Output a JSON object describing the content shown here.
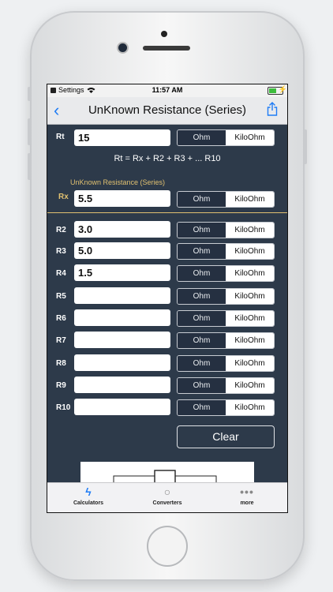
{
  "statusbar": {
    "carrier": "Settings",
    "time": "11:57 AM"
  },
  "navbar": {
    "back_glyph": "‹",
    "title": "UnKnown Resistance (Series)"
  },
  "units": {
    "ohm": "Ohm",
    "kiloohm": "KiloOhm"
  },
  "rt": {
    "label": "Rt",
    "value": "15"
  },
  "formula": "Rt = Rx + R2 + R3 + ... R10",
  "rx": {
    "caption": "UnKnown Resistance (Series)",
    "label": "Rx",
    "value": "5.5"
  },
  "rows": [
    {
      "label": "R2",
      "value": "3.0"
    },
    {
      "label": "R3",
      "value": "5.0"
    },
    {
      "label": "R4",
      "value": "1.5"
    },
    {
      "label": "R5",
      "value": ""
    },
    {
      "label": "R6",
      "value": ""
    },
    {
      "label": "R7",
      "value": ""
    },
    {
      "label": "R8",
      "value": ""
    },
    {
      "label": "R9",
      "value": ""
    },
    {
      "label": "R10",
      "value": ""
    }
  ],
  "clear_label": "Clear",
  "tabs": [
    {
      "label": "Calculators",
      "icon": "bolt-icon",
      "glyph": "ϟ"
    },
    {
      "label": "Converters",
      "icon": "bolt-circle-icon",
      "glyph": "○"
    },
    {
      "label": "more",
      "icon": "more-dots-icon",
      "glyph": "•••"
    }
  ],
  "colors": {
    "background": "#2d3a4a",
    "accent": "#1f7cf5",
    "gold": "#e0c070"
  }
}
